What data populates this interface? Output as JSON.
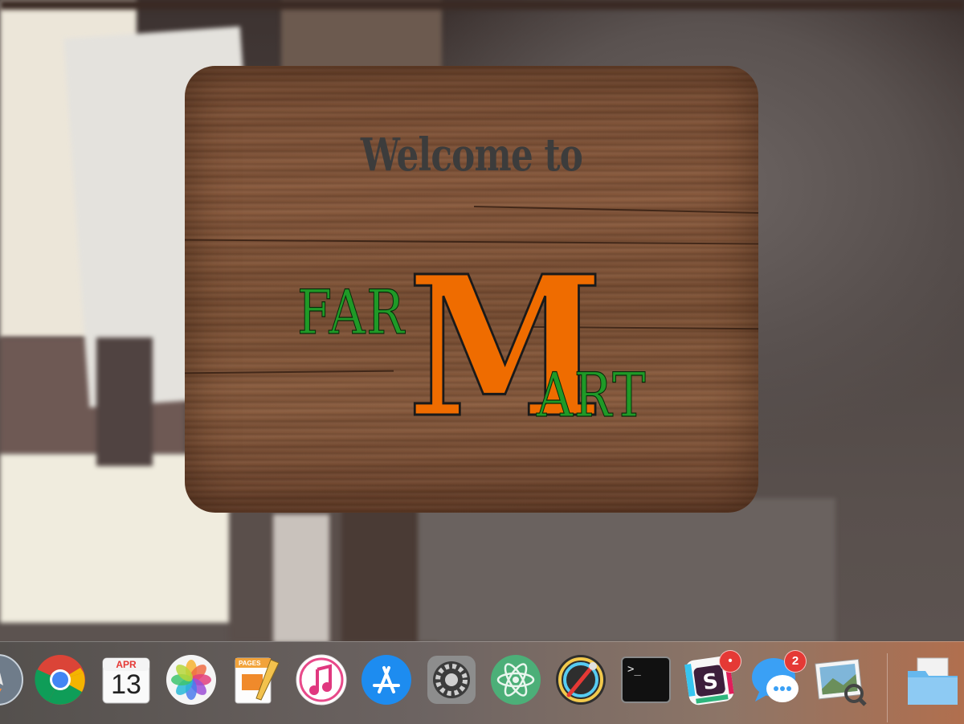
{
  "welcome_card": {
    "greeting": "Welcome to",
    "logo_far": "FAR",
    "logo_m": "M",
    "logo_art": "ART"
  },
  "dock": {
    "apps": [
      {
        "name": "launchpad-icon"
      },
      {
        "name": "chrome-icon"
      },
      {
        "name": "calendar-icon",
        "month": "APR",
        "day": "13"
      },
      {
        "name": "photos-icon"
      },
      {
        "name": "pages-icon",
        "label": "PAGES"
      },
      {
        "name": "itunes-icon"
      },
      {
        "name": "app-store-icon"
      },
      {
        "name": "system-preferences-icon"
      },
      {
        "name": "atom-icon"
      },
      {
        "name": "digital-color-meter-icon"
      },
      {
        "name": "terminal-icon",
        "prompt": ">_"
      },
      {
        "name": "slack-icon",
        "badge": "•"
      },
      {
        "name": "messages-icon",
        "badge": "2"
      },
      {
        "name": "preview-icon"
      },
      {
        "name": "downloads-folder-icon"
      }
    ]
  },
  "colors": {
    "logo_green": "#1f9a27",
    "logo_orange": "#ef6c00",
    "welcome_text": "#3c3c3c"
  }
}
